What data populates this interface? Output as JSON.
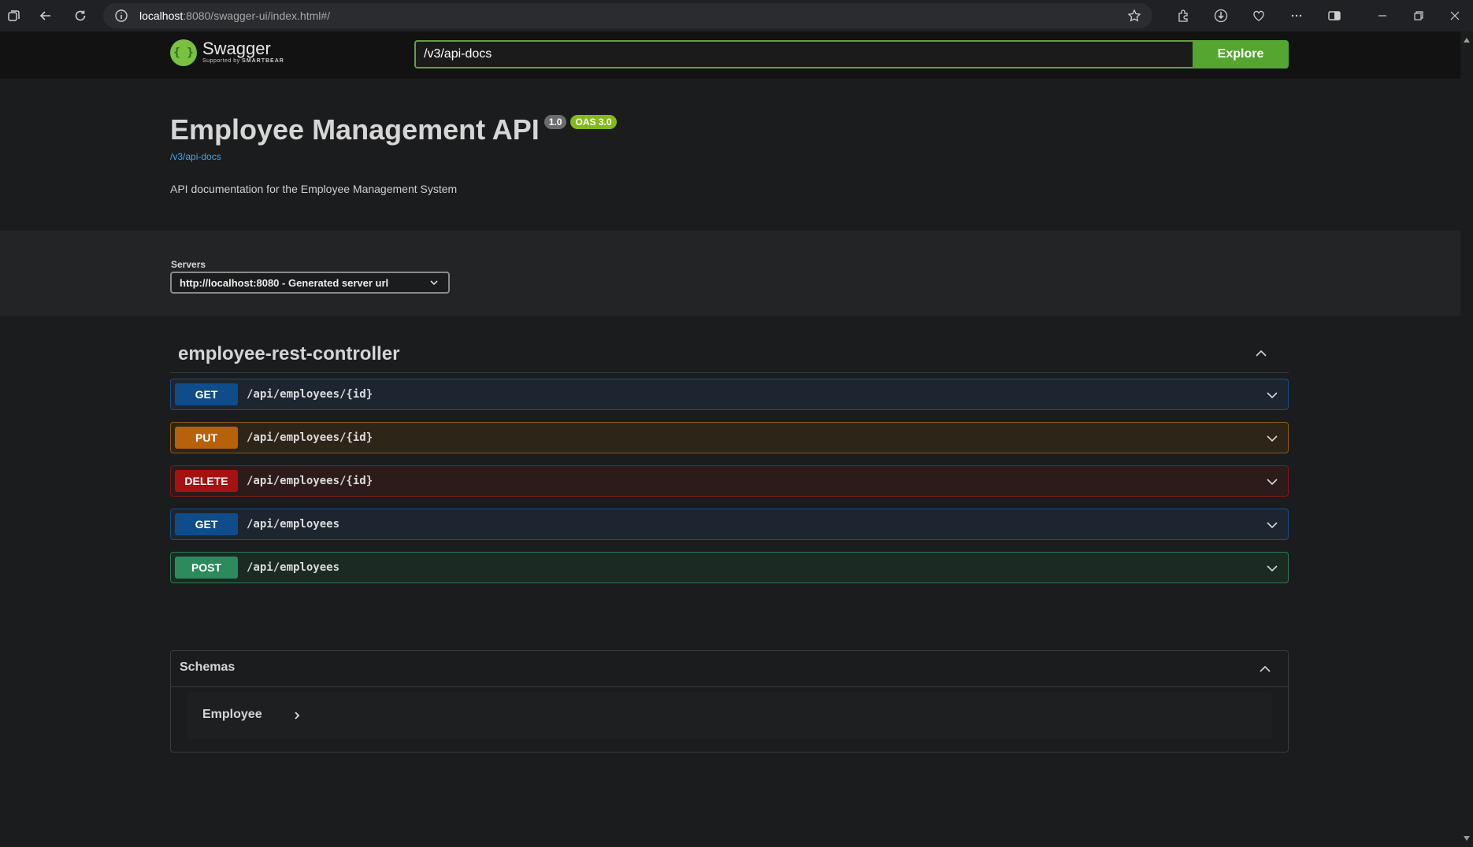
{
  "browser": {
    "url_host": "localhost",
    "url_rest": ":8080/swagger-ui/index.html#/",
    "icons": [
      "tab-actions-icon",
      "back-icon",
      "reload-icon",
      "info-icon",
      "favorite-star-icon",
      "extensions-icon",
      "downloads-icon",
      "browser-essentials-icon",
      "more-icon",
      "split-screen-icon",
      "minimize-icon",
      "restore-icon",
      "close-icon"
    ]
  },
  "topbar": {
    "logo_title": "Swagger",
    "logo_sub_prefix": "Supported by",
    "logo_sub_brand": "SMARTBEAR",
    "url_value": "/v3/api-docs",
    "explore_label": "Explore"
  },
  "info": {
    "title": "Employee Management API",
    "version": "1.0",
    "oas": "OAS 3.0",
    "link": "/v3/api-docs",
    "description": "API documentation for the Employee Management System"
  },
  "servers": {
    "label": "Servers",
    "selected": "http://localhost:8080 - Generated server url"
  },
  "tag": {
    "name": "employee-rest-controller"
  },
  "operations": [
    {
      "method": "GET",
      "path": "/api/employees/{id}",
      "color": "#0f4c8a",
      "bg": "#1d2630",
      "border": "#1a4e84"
    },
    {
      "method": "PUT",
      "path": "/api/employees/{id}",
      "color": "#b5620b",
      "bg": "#2e2519",
      "border": "#8d5a14"
    },
    {
      "method": "DELETE",
      "path": "/api/employees/{id}",
      "color": "#a61111",
      "bg": "#2d1b1b",
      "border": "#7a1a1a"
    },
    {
      "method": "GET",
      "path": "/api/employees",
      "color": "#0f4c8a",
      "bg": "#1d2630",
      "border": "#1a4e84"
    },
    {
      "method": "POST",
      "path": "/api/employees",
      "color": "#2c8a5c",
      "bg": "#1b2a23",
      "border": "#2d7a52"
    }
  ],
  "schemas": {
    "title": "Schemas",
    "models": [
      "Employee"
    ]
  }
}
